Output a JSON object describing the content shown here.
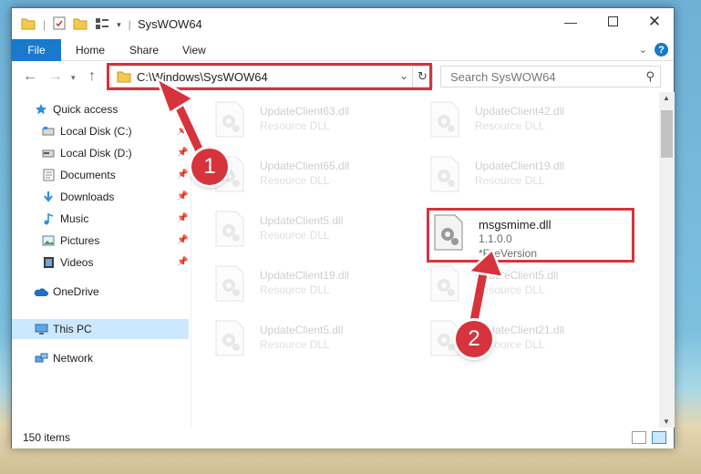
{
  "window": {
    "title": "SysWOW64"
  },
  "ribbon": {
    "tabs": [
      "File",
      "Home",
      "Share",
      "View"
    ]
  },
  "address": {
    "path": "C:\\Windows\\SysWOW64"
  },
  "search": {
    "placeholder": "Search SysWOW64"
  },
  "nav": {
    "items": [
      {
        "label": "Quick access",
        "icon": "star-icon",
        "pinned": false
      },
      {
        "label": "Local Disk (C:)",
        "icon": "drive-icon",
        "pinned": true
      },
      {
        "label": "Local Disk (D:)",
        "icon": "drive-icon",
        "pinned": true
      },
      {
        "label": "Documents",
        "icon": "documents-icon",
        "pinned": true
      },
      {
        "label": "Downloads",
        "icon": "download-icon",
        "pinned": true
      },
      {
        "label": "Music",
        "icon": "music-icon",
        "pinned": true
      },
      {
        "label": "Pictures",
        "icon": "pictures-icon",
        "pinned": true
      },
      {
        "label": "Videos",
        "icon": "videos-icon",
        "pinned": true
      },
      {
        "label": "OneDrive",
        "icon": "cloud-icon",
        "pinned": false
      },
      {
        "label": "This PC",
        "icon": "computer-icon",
        "pinned": false,
        "selected": true
      },
      {
        "label": "Network",
        "icon": "network-icon",
        "pinned": false
      }
    ]
  },
  "files": [
    {
      "name": "UpdateClient63.dll",
      "sub": "Resource DLL",
      "faded": true
    },
    {
      "name": "UpdateClient42.dll",
      "sub": "Resource DLL",
      "faded": true
    },
    {
      "name": "UpdateClient65.dll",
      "sub": "Resource DLL",
      "faded": true
    },
    {
      "name": "UpdateClient19.dll",
      "sub": "Resource DLL",
      "faded": true
    },
    {
      "name": "UpdateClient5.dll",
      "sub": "Resource DLL",
      "faded": true
    },
    {
      "name": "msgsmime.dll",
      "sub": "1.1.0.0",
      "sub2": "*FileVersion",
      "faded": false
    },
    {
      "name": "UpdateClient19.dll",
      "sub": "Resource DLL",
      "faded": true
    },
    {
      "name": "UpdateClient5.dll",
      "sub": "Resource DLL",
      "faded": true
    },
    {
      "name": "UpdateClient5.dll",
      "sub": "Resource DLL",
      "faded": true
    },
    {
      "name": "UpdateClient21.dll",
      "sub": "Resource DLL",
      "faded": true
    }
  ],
  "status": {
    "item_count": "150 items"
  },
  "callouts": {
    "one": "1",
    "two": "2"
  },
  "colors": {
    "accent": "#1979ca",
    "highlight_red": "#d6333c",
    "selected_nav": "#cce8ff"
  }
}
